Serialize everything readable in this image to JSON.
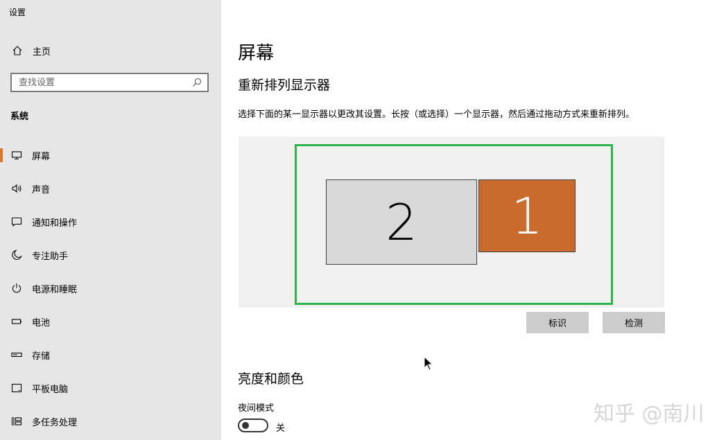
{
  "app": {
    "title": "设置"
  },
  "sidebar": {
    "home": {
      "label": "主页",
      "icon": "home-icon"
    },
    "search": {
      "placeholder": "查找设置",
      "value": "",
      "icon": "search-icon"
    },
    "section_label": "系统",
    "items": [
      {
        "label": "屏幕",
        "icon": "display-icon",
        "active": true
      },
      {
        "label": "声音",
        "icon": "speaker-icon"
      },
      {
        "label": "通知和操作",
        "icon": "notification-icon"
      },
      {
        "label": "专注助手",
        "icon": "moon-icon"
      },
      {
        "label": "电源和睡眠",
        "icon": "power-icon"
      },
      {
        "label": "电池",
        "icon": "battery-icon"
      },
      {
        "label": "存储",
        "icon": "storage-icon"
      },
      {
        "label": "平板电脑",
        "icon": "tablet-icon"
      },
      {
        "label": "多任务处理",
        "icon": "multitasking-icon"
      }
    ],
    "active_color": "#d47a2e"
  },
  "main": {
    "title": "屏幕",
    "rearrange": {
      "heading": "重新排列显示器",
      "description": "选择下面的某一显示器以更改其设置。长按（或选择）一个显示器，然后通过拖动方式来重新排列。",
      "monitors": [
        {
          "number": "2",
          "color": "#d9d9d9",
          "selected": false
        },
        {
          "number": "1",
          "color": "#c96b2c",
          "selected": true
        }
      ],
      "highlight_color": "#2db34a",
      "identify_label": "标识",
      "detect_label": "检测"
    },
    "brightness": {
      "heading": "亮度和颜色",
      "night_light_label": "夜间模式",
      "toggle_state": "关",
      "toggle_on": false
    }
  },
  "watermark": "知乎 @南川"
}
